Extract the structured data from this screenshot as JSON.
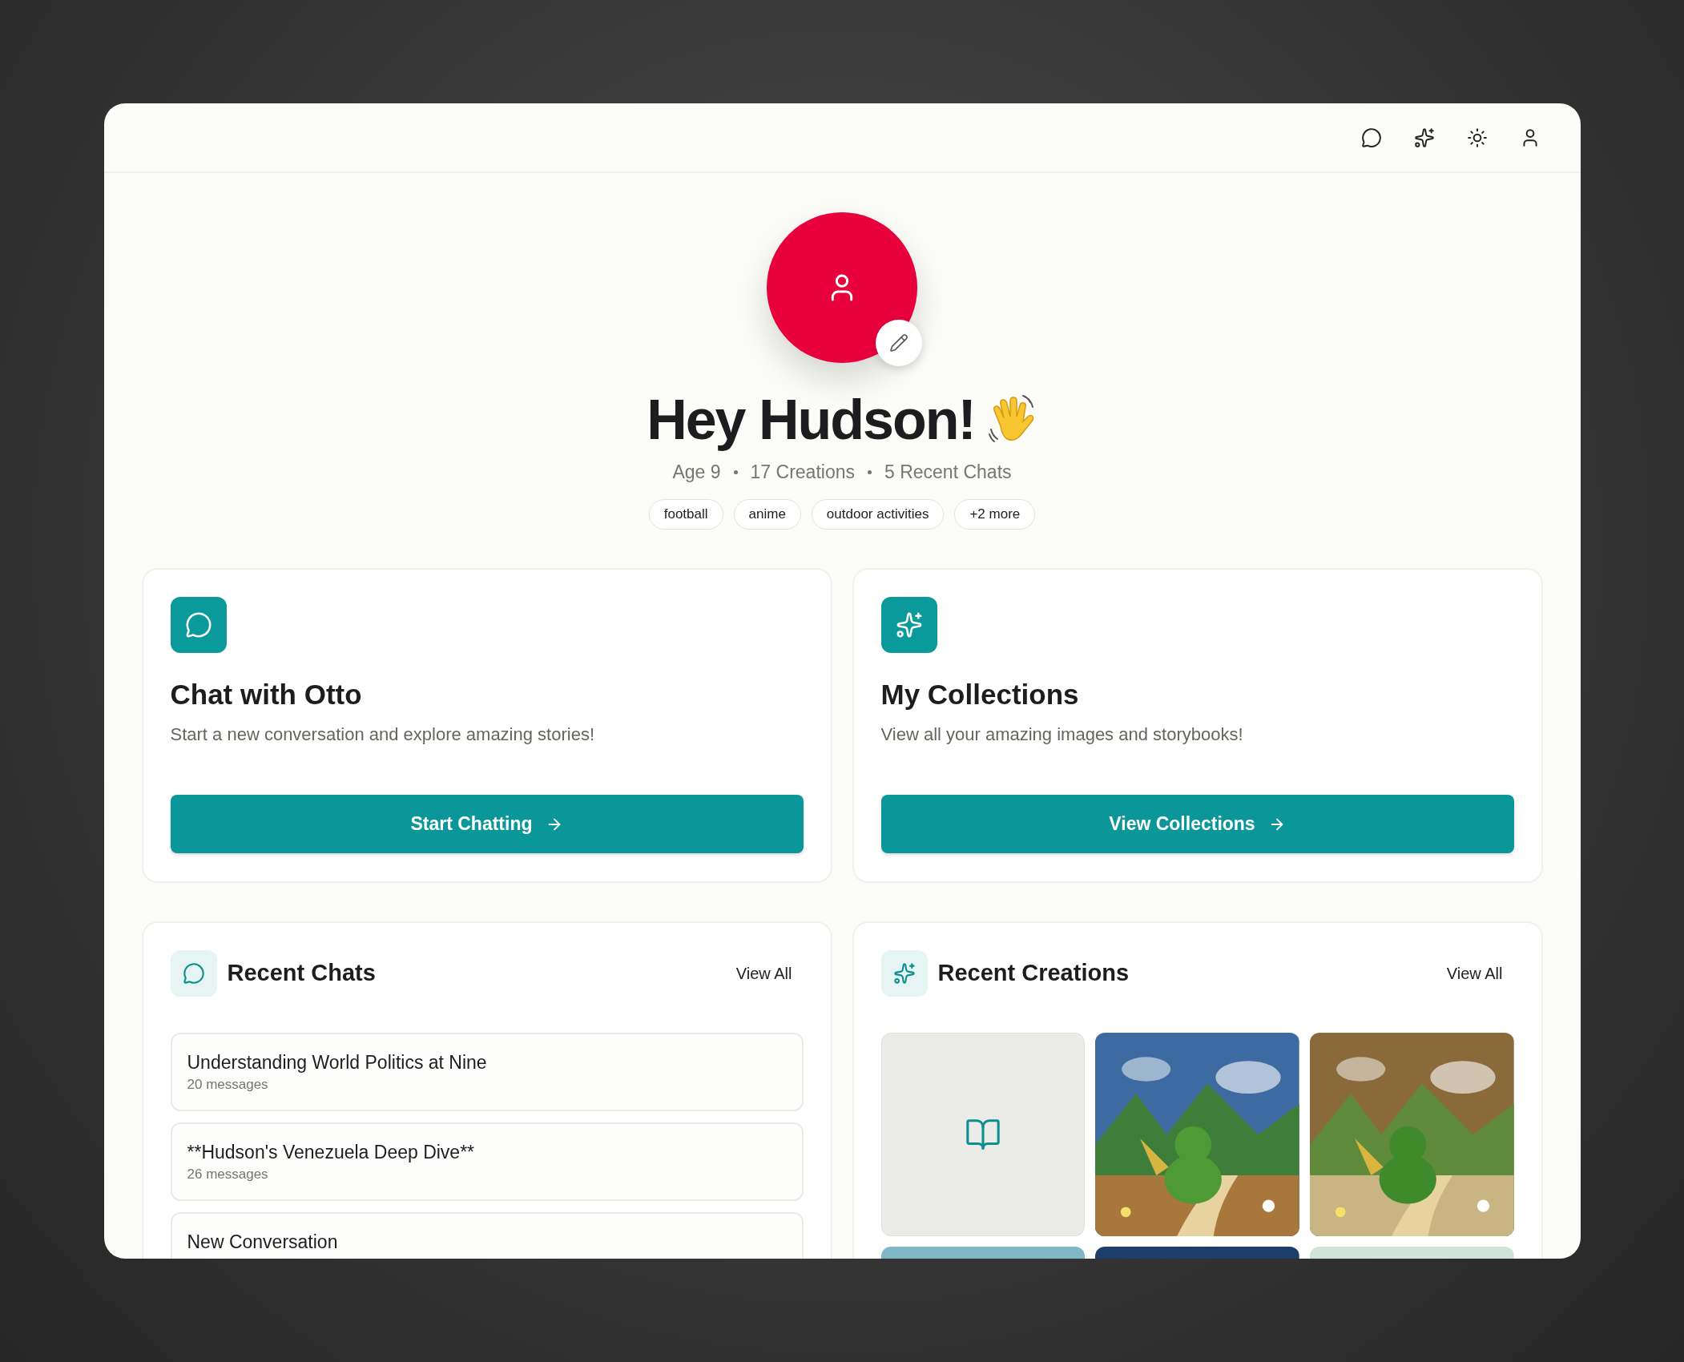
{
  "profile": {
    "name_greeting": "Hey Hudson!",
    "stats": [
      "Age 9",
      "17 Creations",
      "5 Recent Chats"
    ],
    "interests": [
      "football",
      "anime",
      "outdoor activities",
      "+2 more"
    ]
  },
  "action_cards": [
    {
      "kind": "chat",
      "title": "Chat with Otto",
      "description": "Start a new conversation and explore amazing stories!",
      "button": "Start Chatting"
    },
    {
      "kind": "collections",
      "title": "My Collections",
      "description": "View all your amazing images and storybooks!",
      "button": "View Collections"
    }
  ],
  "recent_chats": {
    "title": "Recent Chats",
    "view_all": "View All",
    "items": [
      {
        "title": "Understanding World Politics at Nine",
        "subtitle": "20 messages"
      },
      {
        "title": "**Hudson's Venezuela Deep Dive**",
        "subtitle": "26 messages"
      },
      {
        "title": "New Conversation"
      }
    ]
  },
  "recent_creations": {
    "title": "Recent Creations",
    "view_all": "View All",
    "items": [
      {
        "kind": "storybook"
      },
      {
        "kind": "picture"
      },
      {
        "kind": "picture"
      },
      {
        "kind": "picture"
      },
      {
        "kind": "picture"
      },
      {
        "kind": "picture"
      }
    ]
  }
}
